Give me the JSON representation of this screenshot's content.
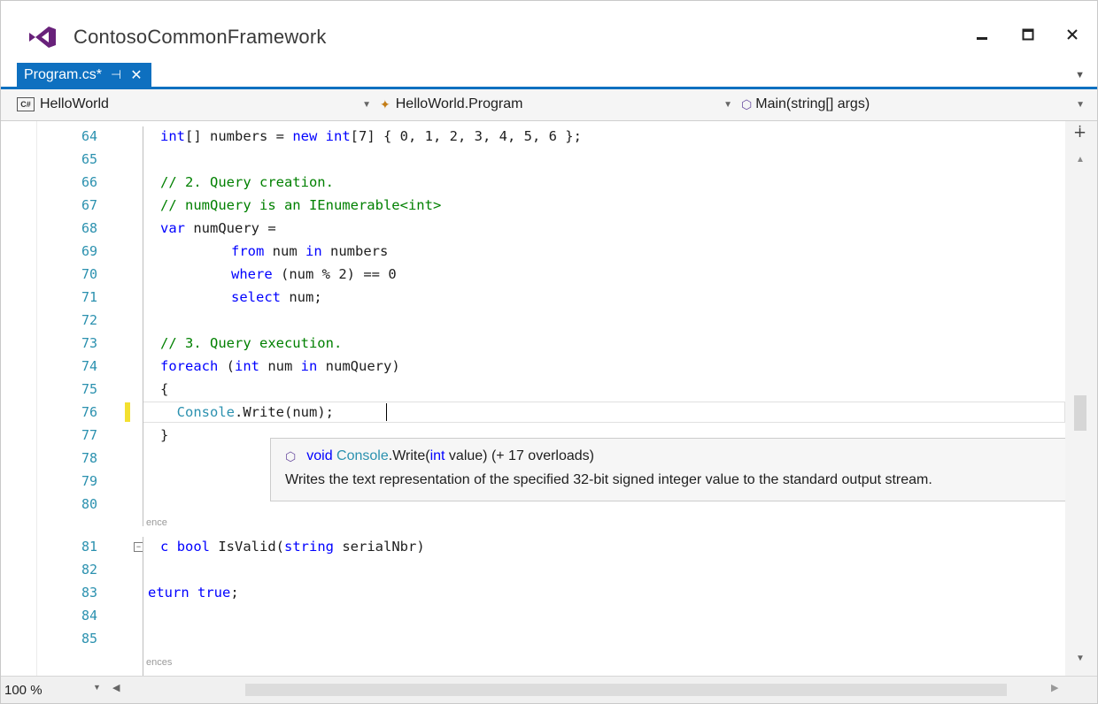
{
  "window": {
    "title": "ContosoCommonFramework",
    "controls": {
      "minimize": "minimize-icon",
      "maximize": "maximize-icon",
      "close": "close-icon"
    }
  },
  "tabs": [
    {
      "label": "Program.cs*",
      "pin_glyph": "⊣",
      "close_glyph": "✕",
      "active": true
    }
  ],
  "navbar": {
    "project": "HelloWorld",
    "type": "HelloWorld.Program",
    "member": "Main(string[] args)",
    "project_badge": "C#"
  },
  "editor": {
    "line_numbers": [
      "64",
      "65",
      "66",
      "67",
      "68",
      "69",
      "70",
      "71",
      "72",
      "73",
      "74",
      "75",
      "76",
      "77",
      "78",
      "79",
      "80",
      "81",
      "82",
      "83",
      "84",
      "85"
    ],
    "code_lines": [
      {
        "ln": "64",
        "parts": [
          [
            "kw",
            "int"
          ],
          [
            "tx",
            "[] numbers = "
          ],
          [
            "kw",
            "new"
          ],
          [
            "tx",
            " "
          ],
          [
            "kw",
            "int"
          ],
          [
            "tx",
            "[7] { 0, 1, 2, 3, 4, 5, 6 };"
          ]
        ]
      },
      {
        "ln": "65",
        "parts": []
      },
      {
        "ln": "66",
        "parts": [
          [
            "cm",
            "// 2. Query creation."
          ]
        ]
      },
      {
        "ln": "67",
        "parts": [
          [
            "cm",
            "// numQuery is an IEnumerable<int>"
          ]
        ]
      },
      {
        "ln": "68",
        "parts": [
          [
            "kw",
            "var"
          ],
          [
            "tx",
            " numQuery ="
          ]
        ]
      },
      {
        "ln": "69",
        "parts": [
          [
            "tx",
            "      "
          ],
          [
            "kw",
            "from"
          ],
          [
            "tx",
            " num "
          ],
          [
            "kw",
            "in"
          ],
          [
            "tx",
            " numbers"
          ]
        ]
      },
      {
        "ln": "70",
        "parts": [
          [
            "tx",
            "      "
          ],
          [
            "kw",
            "where"
          ],
          [
            "tx",
            " (num % 2) == 0"
          ]
        ]
      },
      {
        "ln": "71",
        "parts": [
          [
            "tx",
            "      "
          ],
          [
            "kw",
            "select"
          ],
          [
            "tx",
            " num;"
          ]
        ]
      },
      {
        "ln": "72",
        "parts": []
      },
      {
        "ln": "73",
        "parts": [
          [
            "cm",
            "// 3. Query execution."
          ]
        ]
      },
      {
        "ln": "74",
        "parts": [
          [
            "kw",
            "foreach"
          ],
          [
            "tx",
            " ("
          ],
          [
            "kw",
            "int"
          ],
          [
            "tx",
            " num "
          ],
          [
            "kw",
            "in"
          ],
          [
            "tx",
            " numQuery)"
          ]
        ]
      },
      {
        "ln": "75",
        "parts": [
          [
            "tx",
            "{"
          ]
        ]
      },
      {
        "ln": "76",
        "parts": [
          [
            "tx",
            "  "
          ],
          [
            "ty",
            "Console"
          ],
          [
            "tx",
            ".Write(num);"
          ]
        ]
      },
      {
        "ln": "77",
        "parts": [
          [
            "tx",
            "}"
          ]
        ]
      },
      {
        "ln": "78",
        "parts": []
      },
      {
        "ln": "79",
        "parts": []
      },
      {
        "ln": "80",
        "parts": []
      },
      {
        "ln": "81",
        "parts": [
          [
            "kw",
            "c"
          ],
          [
            "tx",
            " "
          ],
          [
            "kw",
            "bool"
          ],
          [
            "tx",
            " IsValid("
          ],
          [
            "kw",
            "string"
          ],
          [
            "tx",
            " serialNbr)"
          ]
        ]
      },
      {
        "ln": "82",
        "parts": []
      },
      {
        "ln": "83",
        "parts": [
          [
            "kw",
            "eturn"
          ],
          [
            "tx",
            " "
          ],
          [
            "kw",
            "true"
          ],
          [
            "tx",
            ";"
          ]
        ]
      },
      {
        "ln": "84",
        "parts": []
      },
      {
        "ln": "85",
        "parts": []
      }
    ],
    "codelens": [
      "ence",
      "ences"
    ],
    "current_line": "76",
    "changed_line": "76"
  },
  "tooltip": {
    "signature_kw": "void",
    "signature_type": "Console",
    "signature_method": ".Write(",
    "signature_param_kw": "int",
    "signature_rest": " value) (+ 17 overloads)",
    "description": "Writes the text representation of the specified 32-bit signed integer value to the standard output stream."
  },
  "statusbar": {
    "zoom": "100 %"
  },
  "colors": {
    "accent": "#0e70c0",
    "keyword": "#0000ff",
    "comment": "#008000",
    "type": "#2b91af",
    "line_number": "#2b91af",
    "change_marker": "#f3e030"
  }
}
